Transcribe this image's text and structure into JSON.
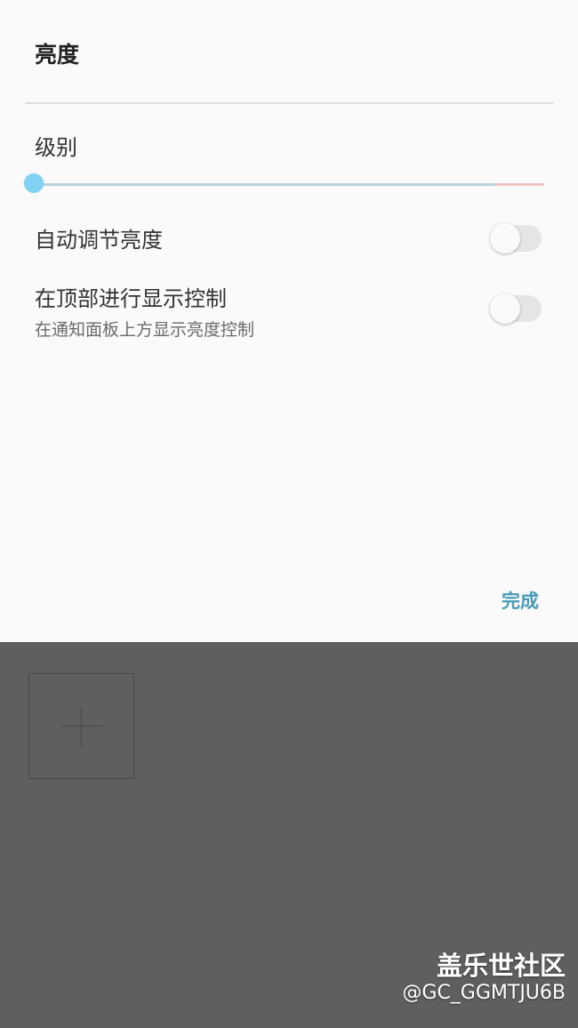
{
  "dialog": {
    "title": "亮度",
    "level_label": "级别",
    "slider": {
      "value": 0
    },
    "auto_brightness": {
      "label": "自动调节亮度",
      "enabled": false
    },
    "show_control_on_top": {
      "label": "在顶部进行显示控制",
      "description": "在通知面板上方显示亮度控制",
      "enabled": false
    },
    "done_label": "完成"
  },
  "watermark": {
    "site": "盖乐世社区",
    "handle": "@GC_GGMTJU6B"
  },
  "colors": {
    "accent": "#4a9ab8",
    "slider_thumb": "#7fd2f3",
    "slider_track": "#b9cfdc",
    "slider_track_end": "#f0c3c6",
    "overlay": "#5f5f5f",
    "dialog_bg": "#fafafa"
  },
  "icons": {
    "add": "plus-icon"
  }
}
